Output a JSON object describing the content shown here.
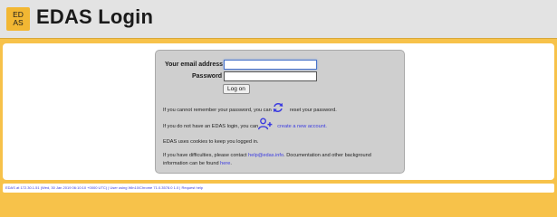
{
  "header": {
    "logo_top": "ED",
    "logo_bottom": "AS",
    "title": "EDAS Login"
  },
  "form": {
    "email_label": "Your email address",
    "password_label": "Password",
    "email_value": "",
    "password_value": "",
    "submit_label": "Log on"
  },
  "help": {
    "forgot_pre": "If you cannot remember your password, you can",
    "forgot_post": "reset your password.",
    "no_account_pre": "If you do not have an EDAS login, you can",
    "no_account_link": "create a new account.",
    "cookies": "EDAS uses cookies to keep you logged in.",
    "difficulty_pre": "If you have difficulties, please contact",
    "difficulty_email": "help@edas.info",
    "difficulty_post": ". Documentation and other background",
    "info_pre": "information can be found",
    "info_link": "here",
    "info_post": "."
  },
  "footer": {
    "text": "EDAS at 172.30.1.51 (Wed, 30 Jan 2019 06:10:10 +0000 UTC) | User using Win10/Chrome 71.0.3578.0 1.0 | Request help"
  },
  "colors": {
    "accent": "#f7c24a",
    "panel": "#cfcfcf",
    "link": "#3a3ae0"
  }
}
